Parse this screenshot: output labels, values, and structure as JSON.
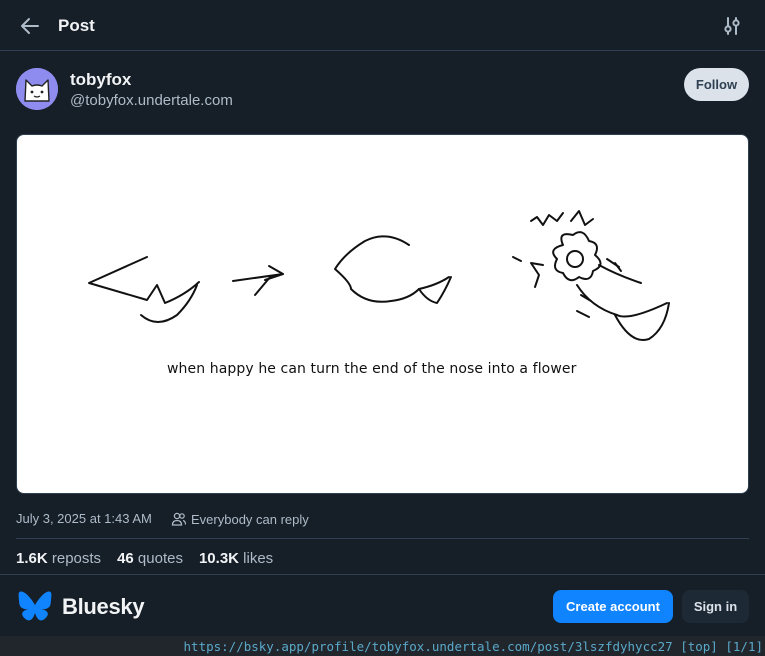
{
  "header": {
    "title": "Post",
    "back_icon": "arrow-left-icon",
    "settings_icon": "sliders-icon"
  },
  "author": {
    "display_name": "tobyfox",
    "handle": "@tobyfox.undertale.com",
    "avatar_icon": "cat-avatar"
  },
  "follow_label": "Follow",
  "post": {
    "image_caption": "when happy he can turn the end of the nose into a flower",
    "timestamp": "July 3, 2025 at 1:43 AM",
    "reply_setting": "Everybody can reply"
  },
  "stats": {
    "reposts_count": "1.6K",
    "reposts_label": "reposts",
    "quotes_count": "46",
    "quotes_label": "quotes",
    "likes_count": "10.3K",
    "likes_label": "likes"
  },
  "footer": {
    "brand_name": "Bluesky",
    "create_account_label": "Create account",
    "sign_in_label": "Sign in",
    "brand_color": "#1083fe"
  },
  "statusbar": {
    "text": "https://bsky.app/profile/tobyfox.undertale.com/post/3lszfdyhycc27 [top] [1/1]"
  }
}
